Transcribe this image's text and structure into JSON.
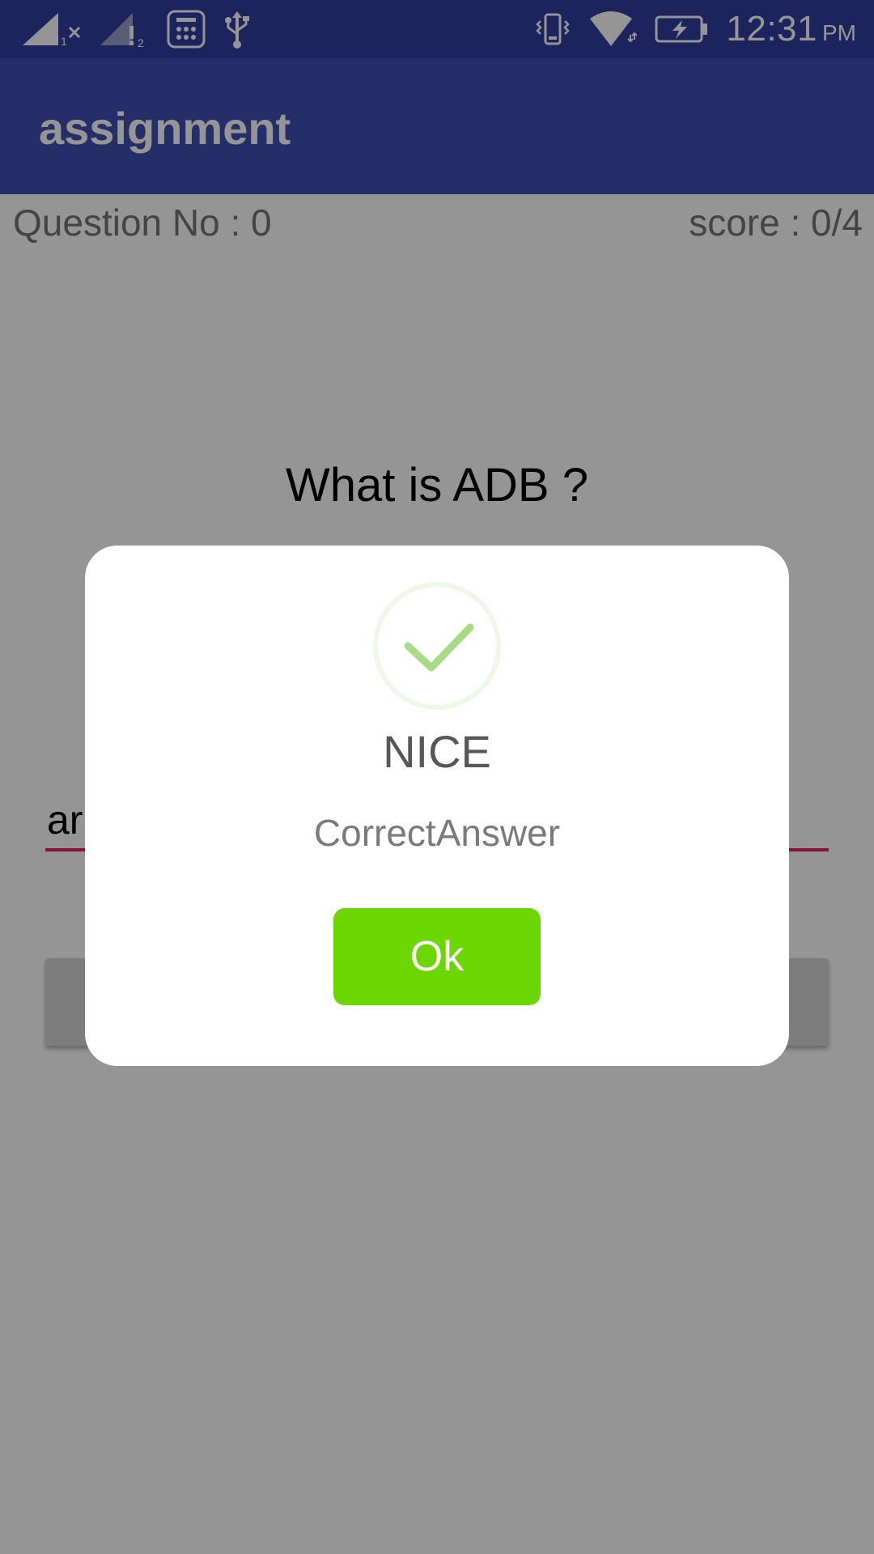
{
  "status_bar": {
    "time": "12:31",
    "ampm": "PM",
    "sim1_label": "1",
    "sim2_label": "2",
    "sim1_icon": "signal-x-icon",
    "sim2_icon": "signal-alert-icon"
  },
  "app_bar": {
    "title": "assignment"
  },
  "quiz": {
    "question_no": "Question No : 0",
    "score": "score : 0/4",
    "question": "What is ADB ?",
    "answer_value": "ar",
    "submit_label": ""
  },
  "dialog": {
    "title": "NICE",
    "message": "CorrectAnswer",
    "ok_label": "Ok"
  },
  "colors": {
    "status_bar": "#303F9F",
    "app_bar": "#3F51B5",
    "accent": "#E91E63",
    "ok_button": "#6BD600",
    "check": "#A5DC86"
  }
}
